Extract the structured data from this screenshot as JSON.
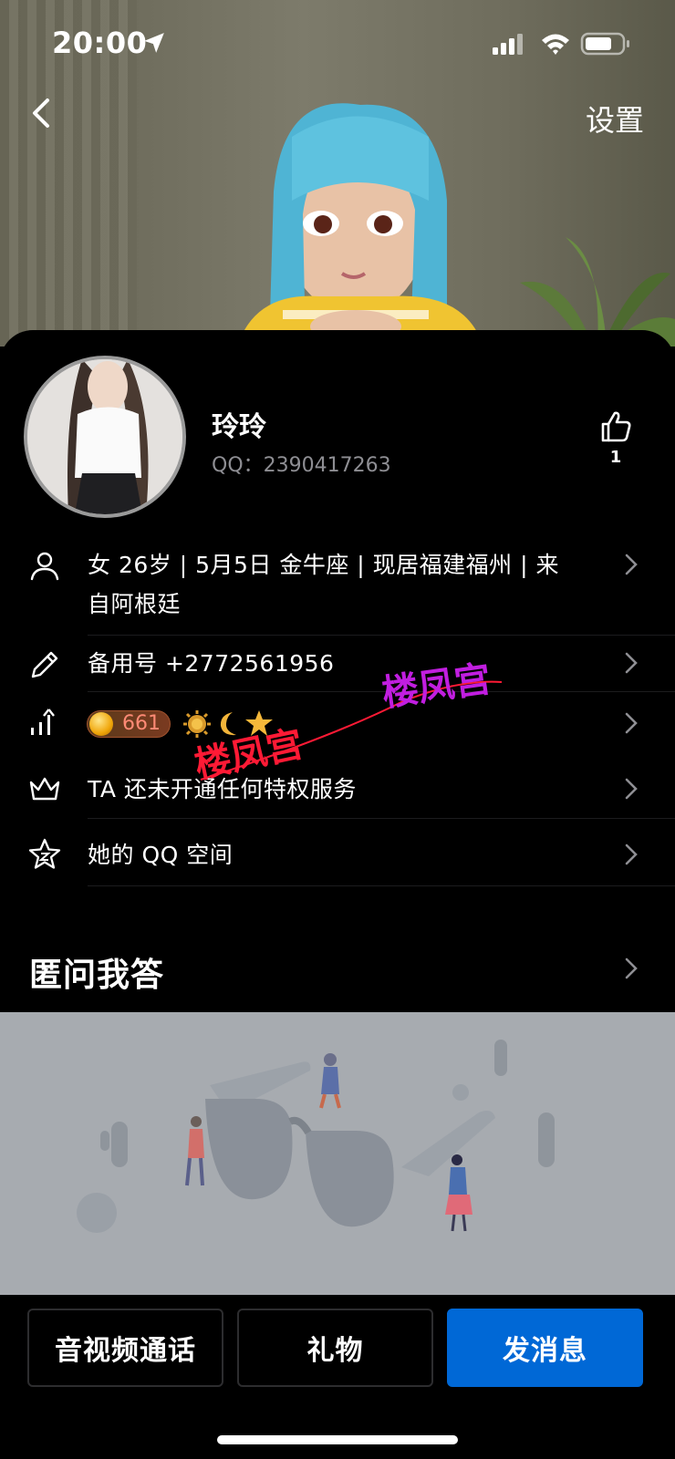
{
  "status_bar": {
    "time": "20:00"
  },
  "nav": {
    "settings_label": "设置"
  },
  "profile": {
    "nickname": "玲玲",
    "qq_line": "QQ：2390417263",
    "like_count": "1"
  },
  "info_rows": {
    "basic_line1": "女 26岁 | 5月5日 金牛座 | 现居福建福州 | 来",
    "basic_line2": "自阿根廷",
    "backup_phone": "备用号 +2772561956",
    "level_value": "661",
    "privilege": "TA 还未开通任何特权服务",
    "qzone": "她的 QQ 空间"
  },
  "watermark": {
    "text1": "楼凤宫",
    "text2": "楼凤宫"
  },
  "section": {
    "title": "匿问我答"
  },
  "actions": {
    "call_label": "音视频通话",
    "gift_label": "礼物",
    "message_label": "发消息"
  },
  "colors": {
    "accent_blue": "#0068d6",
    "muted_text": "#8e8e93",
    "level_text": "#ff8a75"
  }
}
